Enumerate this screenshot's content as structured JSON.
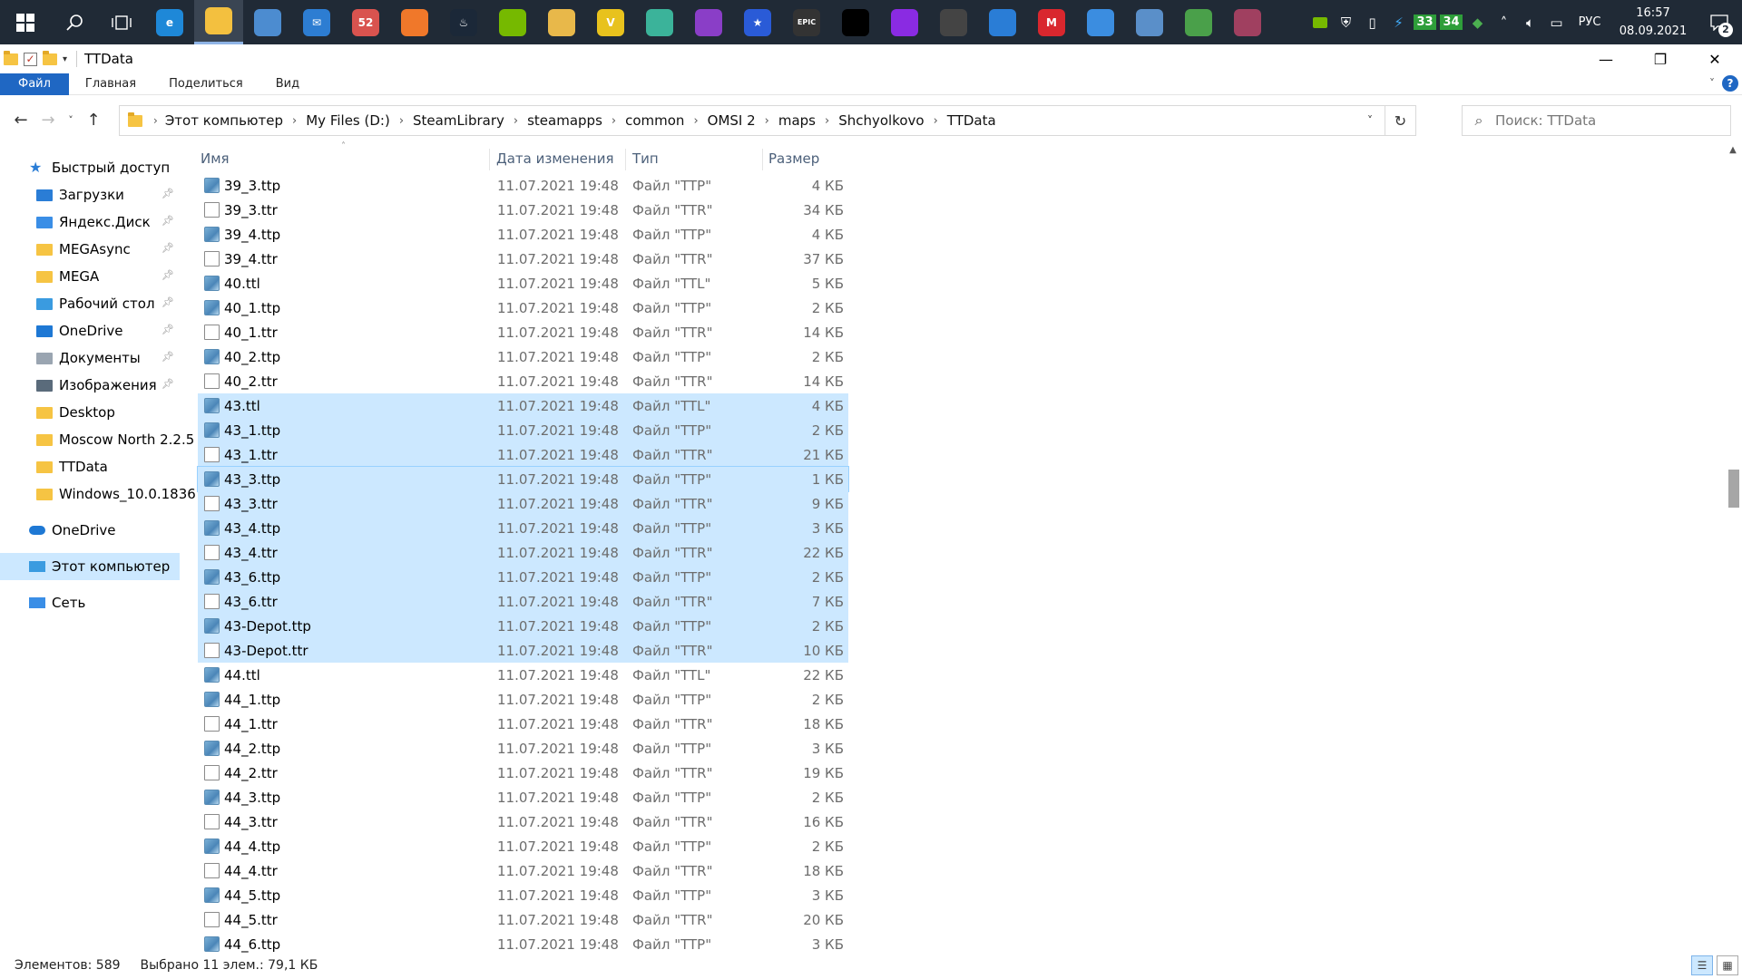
{
  "taskbar": {
    "apps": [
      {
        "icon": "edge-icon",
        "glyph": "e",
        "color": "#1e88d8"
      },
      {
        "icon": "file-explorer-icon",
        "glyph": "",
        "color": "#f3c03f",
        "active": true
      },
      {
        "icon": "store-icon",
        "glyph": "",
        "color": "#4c8cd0"
      },
      {
        "icon": "mail-icon",
        "glyph": "✉",
        "color": "#2d7dd2"
      },
      {
        "icon": "chrome-icon",
        "glyph": "52",
        "color": "#d9534f"
      },
      {
        "icon": "origin-icon",
        "glyph": "",
        "color": "#f0782a"
      },
      {
        "icon": "steam-icon",
        "glyph": "♨",
        "color": "#1b2838"
      },
      {
        "icon": "nvidia-icon",
        "glyph": "",
        "color": "#76b900"
      },
      {
        "icon": "osu-icon",
        "glyph": "",
        "color": "#e8b84a"
      },
      {
        "icon": "v-app-icon",
        "glyph": "V",
        "color": "#e8c21d"
      },
      {
        "icon": "map-app-icon",
        "glyph": "",
        "color": "#3bb39a"
      },
      {
        "icon": "cat-app-icon",
        "glyph": "",
        "color": "#8a3ec7"
      },
      {
        "icon": "star-app-icon",
        "glyph": "★",
        "color": "#2a5bd7"
      },
      {
        "icon": "epic-games-icon",
        "glyph": "EPIC",
        "color": "#333333"
      },
      {
        "icon": "gamepad-icon",
        "glyph": "",
        "color": "#000000"
      },
      {
        "icon": "circle-app-icon",
        "glyph": "",
        "color": "#8a2be2"
      },
      {
        "icon": "game-launcher-icon",
        "glyph": "",
        "color": "#444444"
      },
      {
        "icon": "molecule-app-icon",
        "glyph": "",
        "color": "#2a7dd6"
      },
      {
        "icon": "mega-icon",
        "glyph": "M",
        "color": "#d9272e"
      },
      {
        "icon": "wing-app-icon",
        "glyph": "",
        "color": "#3b8de0"
      },
      {
        "icon": "search-document-icon",
        "glyph": "",
        "color": "#5a8fc9"
      },
      {
        "icon": "spreadsheet-app-icon",
        "glyph": "",
        "color": "#4aa04a"
      },
      {
        "icon": "avatar-app-icon",
        "glyph": "",
        "color": "#a04060"
      }
    ],
    "tray": {
      "badges": [
        "33",
        "34"
      ],
      "language": "РУС",
      "time": "16:57",
      "date": "08.09.2021",
      "notifications": "2"
    }
  },
  "window": {
    "title": "TTData",
    "ribbon_tabs": [
      "Файл",
      "Главная",
      "Поделиться",
      "Вид"
    ]
  },
  "address": {
    "breadcrumbs": [
      "Этот компьютер",
      "My Files (D:)",
      "SteamLibrary",
      "steamapps",
      "common",
      "OMSI 2",
      "maps",
      "Shchyolkovo",
      "TTData"
    ],
    "search_placeholder": "Поиск: TTData"
  },
  "nav": {
    "quick_access": "Быстрый доступ",
    "items": [
      {
        "label": "Загрузки",
        "icon": "download-icon",
        "color": "#2a7dd6",
        "pinned": true
      },
      {
        "label": "Яндекс.Диск",
        "icon": "yandex-disk-icon",
        "color": "#3a8ee6",
        "pinned": true
      },
      {
        "label": "MEGAsync",
        "icon": "mega-folder-icon",
        "color": "#f6c443",
        "pinned": true
      },
      {
        "label": "MEGA",
        "icon": "mega-folder-icon",
        "color": "#f6c443",
        "pinned": true
      },
      {
        "label": "Рабочий стол",
        "icon": "desktop-folder-icon",
        "color": "#3a9be0",
        "pinned": true
      },
      {
        "label": "OneDrive",
        "icon": "onedrive-icon",
        "color": "#1e78d4",
        "pinned": true
      },
      {
        "label": "Документы",
        "icon": "documents-icon",
        "color": "#9aa5b1",
        "pinned": true
      },
      {
        "label": "Изображения",
        "icon": "pictures-icon",
        "color": "#5a6b7b",
        "pinned": true
      },
      {
        "label": "Desktop",
        "icon": "folder-icon",
        "color": "#f6c443",
        "pinned": false
      },
      {
        "label": "Moscow North 2.2.5",
        "icon": "folder-icon",
        "color": "#f6c443",
        "pinned": false
      },
      {
        "label": "TTData",
        "icon": "folder-icon",
        "color": "#f6c443",
        "pinned": false
      },
      {
        "label": "Windows_10.0.1836",
        "icon": "folder-icon",
        "color": "#f6c443",
        "pinned": false
      }
    ],
    "onedrive": "OneDrive",
    "this_pc": "Этот компьютер",
    "network": "Сеть"
  },
  "columns": {
    "name": "Имя",
    "date": "Дата изменения",
    "type": "Тип",
    "size": "Размер"
  },
  "files": [
    {
      "name": "39_3.ttp",
      "date": "11.07.2021 19:48",
      "type": "Файл \"TTP\"",
      "size": "4 КБ",
      "kind": "ttp",
      "selected": false
    },
    {
      "name": "39_3.ttr",
      "date": "11.07.2021 19:48",
      "type": "Файл \"TTR\"",
      "size": "34 КБ",
      "kind": "ttr",
      "selected": false
    },
    {
      "name": "39_4.ttp",
      "date": "11.07.2021 19:48",
      "type": "Файл \"TTP\"",
      "size": "4 КБ",
      "kind": "ttp",
      "selected": false
    },
    {
      "name": "39_4.ttr",
      "date": "11.07.2021 19:48",
      "type": "Файл \"TTR\"",
      "size": "37 КБ",
      "kind": "ttr",
      "selected": false
    },
    {
      "name": "40.ttl",
      "date": "11.07.2021 19:48",
      "type": "Файл \"TTL\"",
      "size": "5 КБ",
      "kind": "ttp",
      "selected": false
    },
    {
      "name": "40_1.ttp",
      "date": "11.07.2021 19:48",
      "type": "Файл \"TTP\"",
      "size": "2 КБ",
      "kind": "ttp",
      "selected": false
    },
    {
      "name": "40_1.ttr",
      "date": "11.07.2021 19:48",
      "type": "Файл \"TTR\"",
      "size": "14 КБ",
      "kind": "ttr",
      "selected": false
    },
    {
      "name": "40_2.ttp",
      "date": "11.07.2021 19:48",
      "type": "Файл \"TTP\"",
      "size": "2 КБ",
      "kind": "ttp",
      "selected": false
    },
    {
      "name": "40_2.ttr",
      "date": "11.07.2021 19:48",
      "type": "Файл \"TTR\"",
      "size": "14 КБ",
      "kind": "ttr",
      "selected": false
    },
    {
      "name": "43.ttl",
      "date": "11.07.2021 19:48",
      "type": "Файл \"TTL\"",
      "size": "4 КБ",
      "kind": "ttp",
      "selected": true
    },
    {
      "name": "43_1.ttp",
      "date": "11.07.2021 19:48",
      "type": "Файл \"TTP\"",
      "size": "2 КБ",
      "kind": "ttp",
      "selected": true
    },
    {
      "name": "43_1.ttr",
      "date": "11.07.2021 19:48",
      "type": "Файл \"TTR\"",
      "size": "21 КБ",
      "kind": "ttr",
      "selected": true
    },
    {
      "name": "43_3.ttp",
      "date": "11.07.2021 19:48",
      "type": "Файл \"TTP\"",
      "size": "1 КБ",
      "kind": "ttp",
      "selected": true,
      "focused": true
    },
    {
      "name": "43_3.ttr",
      "date": "11.07.2021 19:48",
      "type": "Файл \"TTR\"",
      "size": "9 КБ",
      "kind": "ttr",
      "selected": true
    },
    {
      "name": "43_4.ttp",
      "date": "11.07.2021 19:48",
      "type": "Файл \"TTP\"",
      "size": "3 КБ",
      "kind": "ttp",
      "selected": true
    },
    {
      "name": "43_4.ttr",
      "date": "11.07.2021 19:48",
      "type": "Файл \"TTR\"",
      "size": "22 КБ",
      "kind": "ttr",
      "selected": true
    },
    {
      "name": "43_6.ttp",
      "date": "11.07.2021 19:48",
      "type": "Файл \"TTP\"",
      "size": "2 КБ",
      "kind": "ttp",
      "selected": true
    },
    {
      "name": "43_6.ttr",
      "date": "11.07.2021 19:48",
      "type": "Файл \"TTR\"",
      "size": "7 КБ",
      "kind": "ttr",
      "selected": true
    },
    {
      "name": "43-Depot.ttp",
      "date": "11.07.2021 19:48",
      "type": "Файл \"TTP\"",
      "size": "2 КБ",
      "kind": "ttp",
      "selected": true
    },
    {
      "name": "43-Depot.ttr",
      "date": "11.07.2021 19:48",
      "type": "Файл \"TTR\"",
      "size": "10 КБ",
      "kind": "ttr",
      "selected": true
    },
    {
      "name": "44.ttl",
      "date": "11.07.2021 19:48",
      "type": "Файл \"TTL\"",
      "size": "22 КБ",
      "kind": "ttp",
      "selected": false
    },
    {
      "name": "44_1.ttp",
      "date": "11.07.2021 19:48",
      "type": "Файл \"TTP\"",
      "size": "2 КБ",
      "kind": "ttp",
      "selected": false
    },
    {
      "name": "44_1.ttr",
      "date": "11.07.2021 19:48",
      "type": "Файл \"TTR\"",
      "size": "18 КБ",
      "kind": "ttr",
      "selected": false
    },
    {
      "name": "44_2.ttp",
      "date": "11.07.2021 19:48",
      "type": "Файл \"TTP\"",
      "size": "3 КБ",
      "kind": "ttp",
      "selected": false
    },
    {
      "name": "44_2.ttr",
      "date": "11.07.2021 19:48",
      "type": "Файл \"TTR\"",
      "size": "19 КБ",
      "kind": "ttr",
      "selected": false
    },
    {
      "name": "44_3.ttp",
      "date": "11.07.2021 19:48",
      "type": "Файл \"TTP\"",
      "size": "2 КБ",
      "kind": "ttp",
      "selected": false
    },
    {
      "name": "44_3.ttr",
      "date": "11.07.2021 19:48",
      "type": "Файл \"TTR\"",
      "size": "16 КБ",
      "kind": "ttr",
      "selected": false
    },
    {
      "name": "44_4.ttp",
      "date": "11.07.2021 19:48",
      "type": "Файл \"TTP\"",
      "size": "2 КБ",
      "kind": "ttp",
      "selected": false
    },
    {
      "name": "44_4.ttr",
      "date": "11.07.2021 19:48",
      "type": "Файл \"TTR\"",
      "size": "18 КБ",
      "kind": "ttr",
      "selected": false
    },
    {
      "name": "44_5.ttp",
      "date": "11.07.2021 19:48",
      "type": "Файл \"TTP\"",
      "size": "3 КБ",
      "kind": "ttp",
      "selected": false
    },
    {
      "name": "44_5.ttr",
      "date": "11.07.2021 19:48",
      "type": "Файл \"TTR\"",
      "size": "20 КБ",
      "kind": "ttr",
      "selected": false
    },
    {
      "name": "44_6.ttp",
      "date": "11.07.2021 19:48",
      "type": "Файл \"TTP\"",
      "size": "3 КБ",
      "kind": "ttp",
      "selected": false
    }
  ],
  "status": {
    "items_count": "Элементов: 589",
    "selection": "Выбрано 11 элем.: 79,1 КБ"
  },
  "colors": {
    "accent": "#1f67c3",
    "selection": "#cce8ff",
    "taskbar": "#202a36"
  }
}
